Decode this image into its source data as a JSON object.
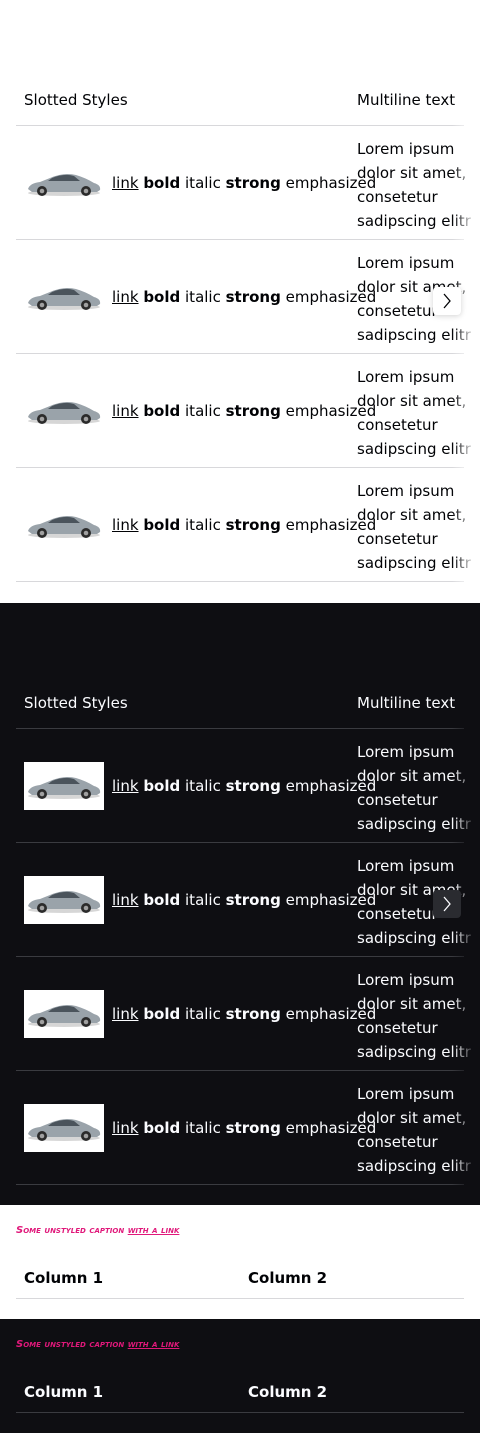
{
  "tables": [
    {
      "theme": "light",
      "header": {
        "col1": "Slotted Styles",
        "col2": "Multiline text"
      },
      "rows": [
        {
          "link": "link",
          "bold": "bold",
          "italic": "italic",
          "strong": "strong",
          "em": "emphasized",
          "multiline": "Lorem ipsum dolor sit amet, consetetur sadipscing elitr"
        },
        {
          "link": "link",
          "bold": "bold",
          "italic": "italic",
          "strong": "strong",
          "em": "emphasized",
          "multiline": "Lorem ipsum dolor sit amet, consetetur sadipscing elitr"
        },
        {
          "link": "link",
          "bold": "bold",
          "italic": "italic",
          "strong": "strong",
          "em": "emphasized",
          "multiline": "Lorem ipsum dolor sit amet, consetetur sadipscing elitr"
        },
        {
          "link": "link",
          "bold": "bold",
          "italic": "italic",
          "strong": "strong",
          "em": "emphasized",
          "multiline": "Lorem ipsum dolor sit amet, consetetur sadipscing elitr"
        }
      ],
      "scroll_icon": "chevron-right-icon"
    },
    {
      "theme": "dark",
      "header": {
        "col1": "Slotted Styles",
        "col2": "Multiline text"
      },
      "rows": [
        {
          "link": "link",
          "bold": "bold",
          "italic": "italic",
          "strong": "strong",
          "em": "emphasized",
          "multiline": "Lorem ipsum dolor sit amet, consetetur sadipscing elitr"
        },
        {
          "link": "link",
          "bold": "bold",
          "italic": "italic",
          "strong": "strong",
          "em": "emphasized",
          "multiline": "Lorem ipsum dolor sit amet, consetetur sadipscing elitr"
        },
        {
          "link": "link",
          "bold": "bold",
          "italic": "italic",
          "strong": "strong",
          "em": "emphasized",
          "multiline": "Lorem ipsum dolor sit amet, consetetur sadipscing elitr"
        },
        {
          "link": "link",
          "bold": "bold",
          "italic": "italic",
          "strong": "strong",
          "em": "emphasized",
          "multiline": "Lorem ipsum dolor sit amet, consetetur sadipscing elitr"
        }
      ],
      "scroll_icon": "chevron-right-icon"
    }
  ],
  "caption_tables": [
    {
      "theme": "light",
      "caption_text": "Some unstyled caption",
      "caption_link": "with a link",
      "col1": "Column 1",
      "col2": "Column 2"
    },
    {
      "theme": "dark",
      "caption_text": "Some unstyled caption",
      "caption_link": "with a link",
      "col1": "Column 1",
      "col2": "Column 2"
    }
  ],
  "colors": {
    "accent_caption": "#e0187a",
    "dark_bg": "#0e0e12",
    "light_bg": "#ffffff"
  }
}
